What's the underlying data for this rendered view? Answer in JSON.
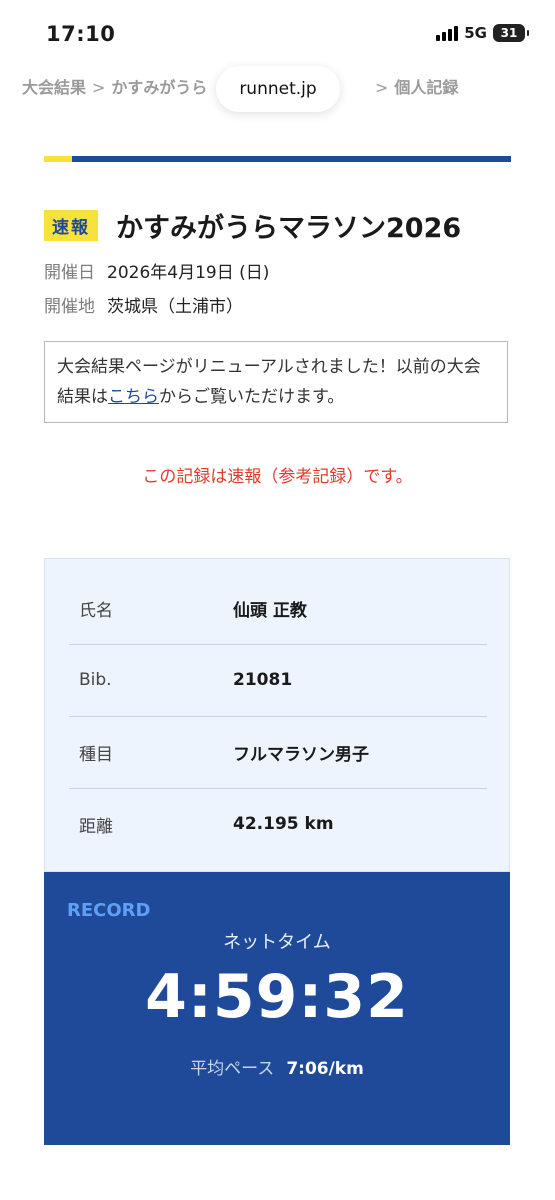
{
  "status_bar": {
    "time": "17:10",
    "network": "5G",
    "battery": "31"
  },
  "browser": {
    "url": "runnet.jp"
  },
  "breadcrumb": {
    "item1": "大会結果",
    "item2": "かすみがうら",
    "item3": "個人記録",
    "separator": ">"
  },
  "race": {
    "badge": "速報",
    "title": "かすみがうらマラソン2026",
    "date_label": "開催日",
    "date_value": "2026年4月19日 (日)",
    "place_label": "開催地",
    "place_value": "茨城県（土浦市）"
  },
  "notice": {
    "text_before": "大会結果ページがリニューアルされました！以前の大会結果は",
    "link_text": "こちら",
    "text_after": "からご覧いただけます。"
  },
  "alert": "この記録は速報（参考記録）です。",
  "info": [
    {
      "label": "氏名",
      "value": "仙頭 正教"
    },
    {
      "label": "Bib.",
      "value": "21081"
    },
    {
      "label": "種目",
      "value": "フルマラソン男子"
    },
    {
      "label": "距離",
      "value": "42.195 km"
    }
  ],
  "record": {
    "tag": "RECORD",
    "net_label": "ネットタイム",
    "net_time": "4:59:32",
    "pace_label": "平均ペース",
    "pace_value": "7:06/km"
  },
  "colors": {
    "brand_blue": "#1f4a9a",
    "badge_yellow": "#f7e23b",
    "alert_red": "#e23b2e",
    "info_bg": "#edf4fd"
  },
  "icons": [
    "cellular-signal-icon",
    "battery-icon"
  ]
}
